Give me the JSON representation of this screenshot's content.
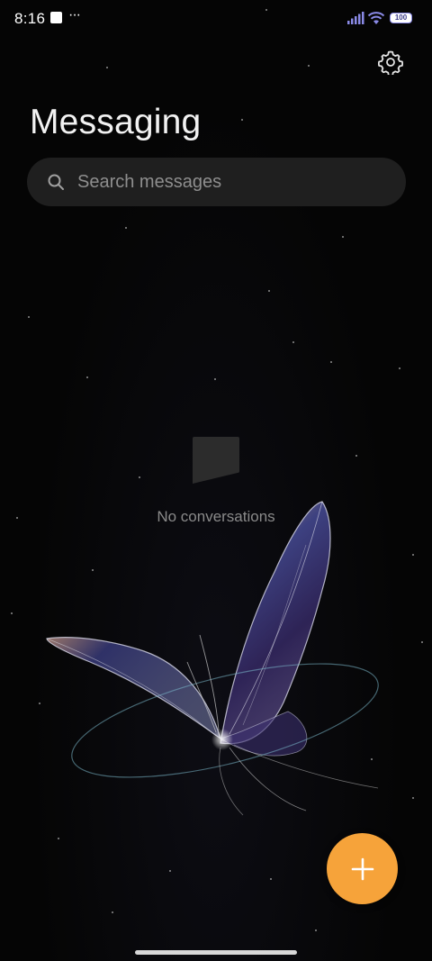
{
  "status_bar": {
    "time": "8:16",
    "more_indicator": "···",
    "battery_level": "100"
  },
  "header": {
    "title": "Messaging",
    "settings_icon": "gear-icon"
  },
  "search": {
    "placeholder": "Search messages",
    "icon": "search-icon"
  },
  "empty_state": {
    "icon": "message-bubble-icon",
    "text": "No conversations"
  },
  "fab": {
    "icon": "plus-icon",
    "color": "#f6a33a"
  },
  "theme": {
    "background": "#050505",
    "search_background": "#1f1f1f",
    "accent": "#f6a33a"
  }
}
